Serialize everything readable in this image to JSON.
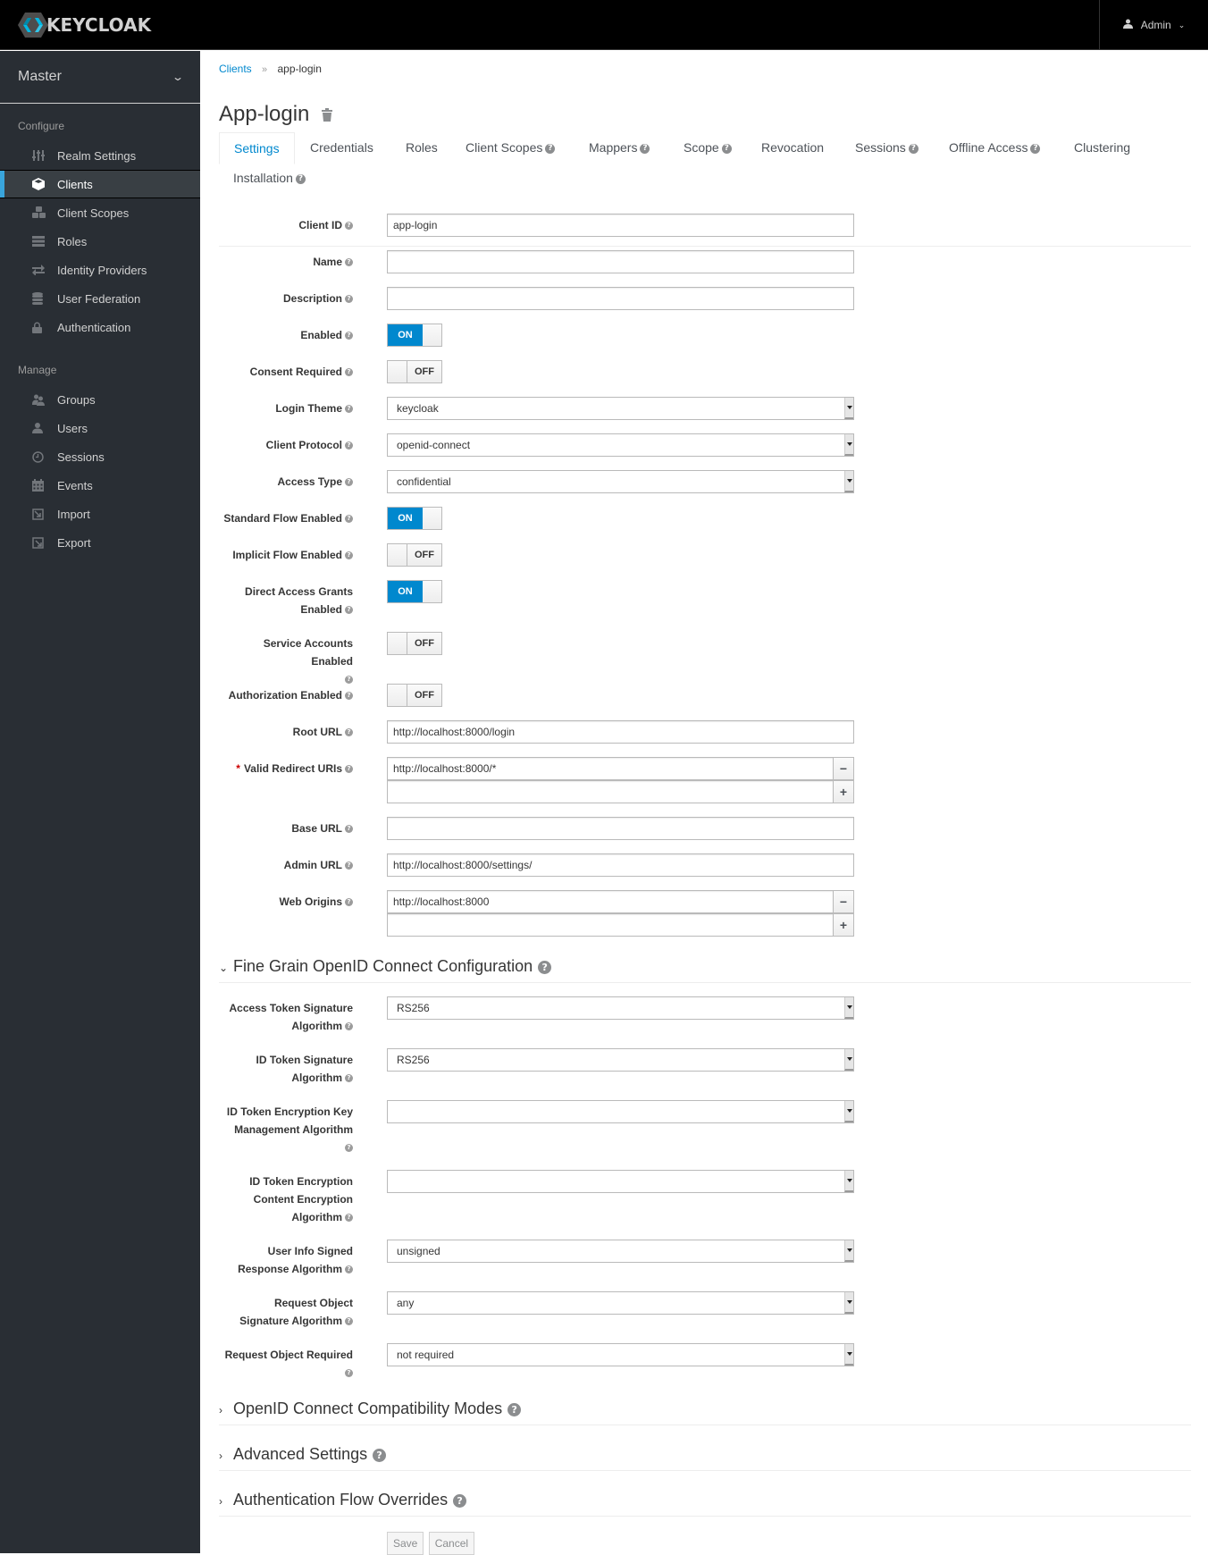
{
  "navbar": {
    "brand": "KEYCLOAK",
    "user": "Admin"
  },
  "sidebar": {
    "realm": "Master",
    "groups": [
      {
        "title": "Configure",
        "items": [
          {
            "label": "Realm Settings",
            "icon": "sliders-icon"
          },
          {
            "label": "Clients",
            "icon": "cube-icon",
            "active": true
          },
          {
            "label": "Client Scopes",
            "icon": "cubes-icon"
          },
          {
            "label": "Roles",
            "icon": "server-icon"
          },
          {
            "label": "Identity Providers",
            "icon": "exchange-icon"
          },
          {
            "label": "User Federation",
            "icon": "database-icon"
          },
          {
            "label": "Authentication",
            "icon": "lock-icon"
          }
        ]
      },
      {
        "title": "Manage",
        "items": [
          {
            "label": "Groups",
            "icon": "users-icon"
          },
          {
            "label": "Users",
            "icon": "user-icon"
          },
          {
            "label": "Sessions",
            "icon": "clock-icon"
          },
          {
            "label": "Events",
            "icon": "calendar-icon"
          },
          {
            "label": "Import",
            "icon": "import-icon"
          },
          {
            "label": "Export",
            "icon": "export-icon"
          }
        ]
      }
    ]
  },
  "breadcrumb": {
    "parent": "Clients",
    "separator": "»",
    "current": "app-login"
  },
  "page": {
    "title": "App-login"
  },
  "tabs": [
    {
      "label": "Settings",
      "active": true,
      "help": false
    },
    {
      "label": "Credentials",
      "help": false
    },
    {
      "label": "Roles",
      "help": false
    },
    {
      "label": "Client Scopes",
      "help": true
    },
    {
      "label": "Mappers",
      "help": true
    },
    {
      "label": "Scope",
      "help": true
    },
    {
      "label": "Revocation",
      "help": false
    },
    {
      "label": "Sessions",
      "help": true
    },
    {
      "label": "Offline Access",
      "help": true
    },
    {
      "label": "Clustering",
      "help": false
    },
    {
      "label": "Installation",
      "help": true
    }
  ],
  "form": {
    "client_id": {
      "label": "Client ID",
      "value": "app-login"
    },
    "name": {
      "label": "Name",
      "value": ""
    },
    "description": {
      "label": "Description",
      "value": ""
    },
    "enabled": {
      "label": "Enabled",
      "state": "ON"
    },
    "consent_required": {
      "label": "Consent Required",
      "state": "OFF"
    },
    "login_theme": {
      "label": "Login Theme",
      "value": "keycloak"
    },
    "client_protocol": {
      "label": "Client Protocol",
      "value": "openid-connect"
    },
    "access_type": {
      "label": "Access Type",
      "value": "confidential"
    },
    "standard_flow": {
      "label": "Standard Flow Enabled",
      "state": "ON"
    },
    "implicit_flow": {
      "label": "Implicit Flow Enabled",
      "state": "OFF"
    },
    "direct_access": {
      "label_line1": "Direct Access Grants",
      "label_line2": "Enabled",
      "state": "ON"
    },
    "service_accounts": {
      "label": "Service Accounts Enabled",
      "state": "OFF"
    },
    "authorization": {
      "label": "Authorization Enabled",
      "state": "OFF"
    },
    "root_url": {
      "label": "Root URL",
      "value": "http://localhost:8000/login"
    },
    "redirect_uris": {
      "label": "Valid Redirect URIs",
      "required_mark": "*",
      "values": [
        "http://localhost:8000/*",
        ""
      ]
    },
    "base_url": {
      "label": "Base URL",
      "value": ""
    },
    "admin_url": {
      "label": "Admin URL",
      "value": "http://localhost:8000/settings/"
    },
    "web_origins": {
      "label": "Web Origins",
      "values": [
        "http://localhost:8000",
        ""
      ]
    },
    "remove_symbol": "−",
    "add_symbol": "+"
  },
  "fine_grain": {
    "title": "Fine Grain OpenID Connect Configuration",
    "fields": {
      "access_token_sig": {
        "label_line1": "Access Token Signature",
        "label_line2": "Algorithm",
        "value": "RS256"
      },
      "id_token_sig": {
        "label_line1": "ID Token Signature",
        "label_line2": "Algorithm",
        "value": "RS256"
      },
      "id_token_enc_key": {
        "label_line1": "ID Token Encryption Key",
        "label_line2": "Management Algorithm",
        "value": ""
      },
      "id_token_enc_content": {
        "label_line1": "ID Token Encryption",
        "label_line2": "Content Encryption",
        "label_line3": "Algorithm",
        "value": ""
      },
      "userinfo_sig": {
        "label_line1": "User Info Signed",
        "label_line2": "Response Algorithm",
        "value": "unsigned"
      },
      "request_object_sig": {
        "label_line1": "Request Object",
        "label_line2": "Signature Algorithm",
        "value": "any"
      },
      "request_object_required": {
        "label": "Request Object Required",
        "value": "not required"
      }
    }
  },
  "sections": {
    "compat": "OpenID Connect Compatibility Modes",
    "advanced": "Advanced Settings",
    "auth_flow": "Authentication Flow Overrides"
  },
  "actions": {
    "save": "Save",
    "cancel": "Cancel"
  },
  "colors": {
    "accent": "#0088ce",
    "sidebar_bg": "#292e34",
    "active_marker": "#39a5dc"
  }
}
